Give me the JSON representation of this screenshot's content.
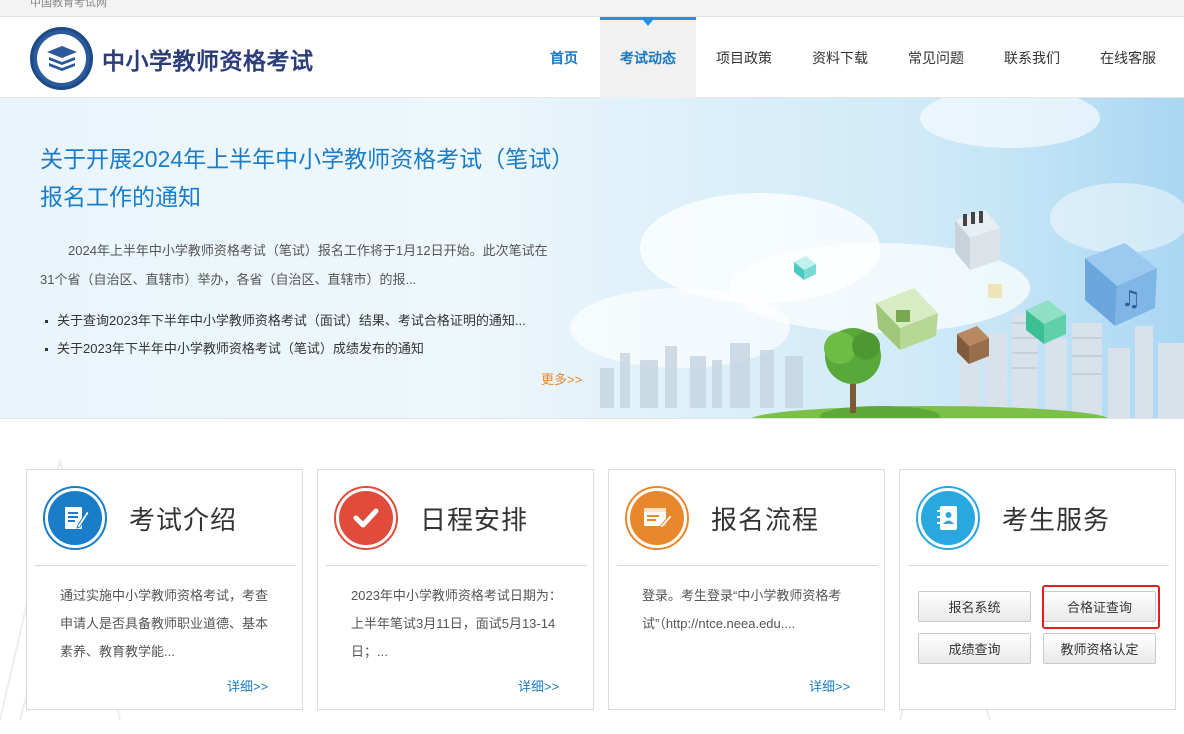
{
  "topbar": {
    "text": "中国教育考试网"
  },
  "header": {
    "site_title": "中小学教师资格考试"
  },
  "nav": [
    {
      "label": "首页"
    },
    {
      "label": "考试动态"
    },
    {
      "label": "项目政策"
    },
    {
      "label": "资料下载"
    },
    {
      "label": "常见问题"
    },
    {
      "label": "联系我们"
    },
    {
      "label": "在线客服"
    }
  ],
  "banner": {
    "title": "关于开展2024年上半年中小学教师资格考试（笔试）报名工作的通知",
    "summary": "2024年上半年中小学教师资格考试（笔试）报名工作将于1月12日开始。此次笔试在31个省（自治区、直辖市）举办，各省（自治区、直辖市）的报...",
    "news": [
      "关于查询2023年下半年中小学教师资格考试（面试）结果、考试合格证明的通知...",
      "关于2023年下半年中小学教师资格考试（笔试）成绩发布的通知"
    ],
    "more": "更多>>"
  },
  "cards": [
    {
      "title": "考试介绍",
      "icon": "document-pen-icon",
      "text": "通过实施中小学教师资格考试，考查申请人是否具备教师职业道德、基本素养、教育教学能...",
      "more": "详细>>"
    },
    {
      "title": "日程安排",
      "icon": "checkmark-icon",
      "text": "2023年中小学教师资格考试日期为：上半年笔试3月11日，面试5月13-14日；...",
      "more": "详细>>"
    },
    {
      "title": "报名流程",
      "icon": "browser-edit-icon",
      "text": "登录。考生登录“中小学教师资格考试”（http://ntce.neea.edu....",
      "more": "详细>>"
    },
    {
      "title": "考生服务",
      "icon": "contact-book-icon"
    }
  ],
  "services": {
    "register": "报名系统",
    "certificate": "合格证查询",
    "score": "成绩查询",
    "qualification": "教师资格认定"
  },
  "colors": {
    "accent": "#1a7dc9",
    "highlight": "#e02020",
    "card1": "#1a7dc9",
    "card2": "#e14b3b",
    "card3": "#e8872b",
    "card4": "#29a8df"
  }
}
